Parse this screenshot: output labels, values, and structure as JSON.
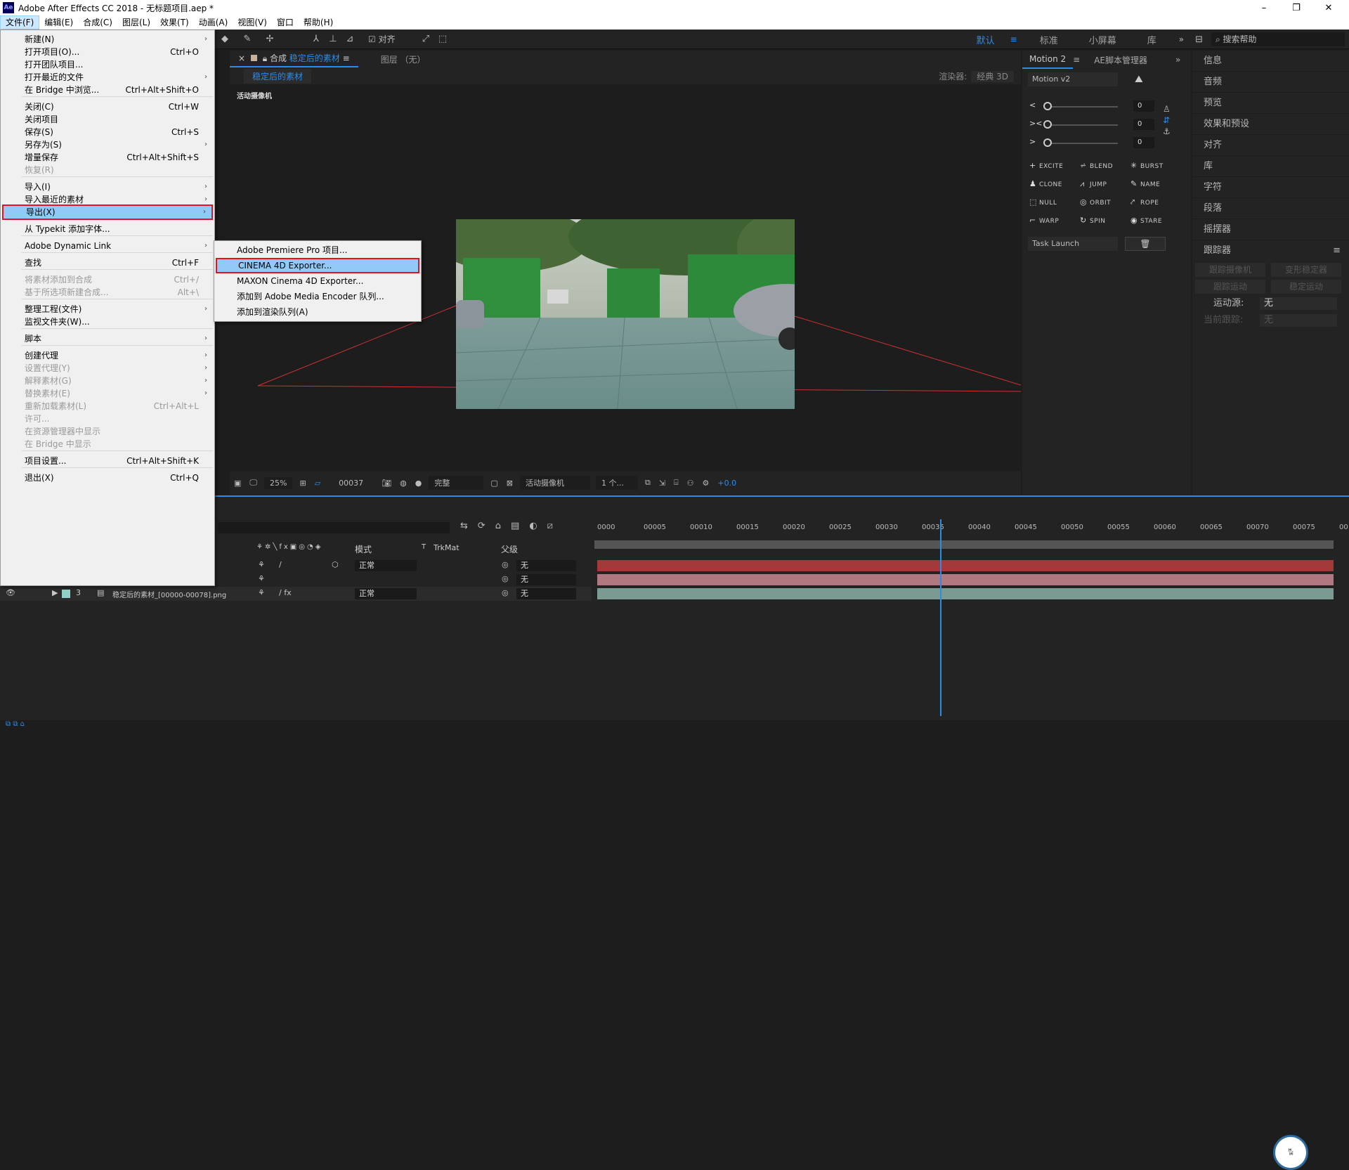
{
  "window": {
    "title": "Adobe After Effects CC 2018 - 无标题项目.aep *",
    "app_icon": "Ae",
    "minimize": "–",
    "restore": "❐",
    "close": "✕"
  },
  "menubar": [
    "文件(F)",
    "编辑(E)",
    "合成(C)",
    "图层(L)",
    "效果(T)",
    "动画(A)",
    "视图(V)",
    "窗口",
    "帮助(H)"
  ],
  "toolbar": {
    "snap_label": "对齐",
    "workspaces": [
      "默认",
      "标准",
      "小屏幕",
      "库"
    ],
    "help_search": "搜索帮助",
    "more": "»"
  },
  "comp_panel": {
    "tab_prefix": "合成",
    "tab_name": "稳定后的素材",
    "layer_tab": "图层 （无）",
    "breadcrumb": "稳定后的素材",
    "renderer_label": "渲染器:",
    "renderer_value": "经典 3D",
    "camera_label": "活动摄像机",
    "bottom": {
      "zoom": "25%",
      "timecode": "00037",
      "resolution": "完整",
      "camera": "活动摄像机",
      "views": "1 个...",
      "exposure": "+0.0"
    }
  },
  "motion_panel": {
    "tabs": [
      "Motion 2",
      "AE脚本管理器"
    ],
    "preset": "Motion v2",
    "slider_values": [
      "0",
      "0",
      "0"
    ],
    "buttons": [
      "EXCITE",
      "BLEND",
      "BURST",
      "CLONE",
      "JUMP",
      "NAME",
      "NULL",
      "ORBIT",
      "ROPE",
      "WARP",
      "SPIN",
      "STARE"
    ],
    "task": "Task Launch"
  },
  "right_panel": {
    "items": [
      "信息",
      "音频",
      "预览",
      "效果和预设",
      "对齐",
      "库",
      "字符",
      "段落",
      "摇摆器"
    ],
    "tracker": {
      "title": "跟踪器",
      "buttons": [
        "跟踪摄像机",
        "变形稳定器",
        "跟踪运动",
        "稳定运动"
      ],
      "source_label": "运动源:",
      "source_value": "无",
      "current_label": "当前跟踪:",
      "current_value": "无"
    }
  },
  "timeline": {
    "columns": {
      "mode": "模式",
      "t": "T",
      "trkmat": "TrkMat",
      "parent": "父级"
    },
    "ruler": [
      "0000",
      "00005",
      "00010",
      "00015",
      "00020",
      "00025",
      "00030",
      "00035",
      "00040",
      "00045",
      "00050",
      "00055",
      "00060",
      "00065",
      "00070",
      "00075",
      "00"
    ],
    "layers": [
      {
        "num": "",
        "name": "",
        "mode": "正常",
        "parent": "无",
        "color": "#a33a3a"
      },
      {
        "num": "",
        "name": "",
        "mode": "",
        "parent": "无",
        "color": "#b07880"
      },
      {
        "num": "3",
        "name": "稳定后的素材_[00000-00078].png",
        "mode": "正常",
        "parent": "无",
        "color": "#7a9a92"
      }
    ]
  },
  "file_menu": [
    {
      "label": "新建(N)",
      "shortcut": "",
      "submenu": true,
      "disabled": false
    },
    {
      "label": "打开项目(O)...",
      "shortcut": "Ctrl+O",
      "submenu": false,
      "disabled": false
    },
    {
      "label": "打开团队项目...",
      "shortcut": "",
      "submenu": false,
      "disabled": false
    },
    {
      "label": "打开最近的文件",
      "shortcut": "",
      "submenu": true,
      "disabled": false
    },
    {
      "label": "在 Bridge 中浏览...",
      "shortcut": "Ctrl+Alt+Shift+O",
      "submenu": false,
      "disabled": false
    },
    {
      "label": "关闭(C)",
      "shortcut": "Ctrl+W",
      "submenu": false,
      "disabled": false
    },
    {
      "label": "关闭项目",
      "shortcut": "",
      "submenu": false,
      "disabled": false
    },
    {
      "label": "保存(S)",
      "shortcut": "Ctrl+S",
      "submenu": false,
      "disabled": false
    },
    {
      "label": "另存为(S)",
      "shortcut": "",
      "submenu": true,
      "disabled": false
    },
    {
      "label": "增量保存",
      "shortcut": "Ctrl+Alt+Shift+S",
      "submenu": false,
      "disabled": false
    },
    {
      "label": "恢复(R)",
      "shortcut": "",
      "submenu": false,
      "disabled": true
    },
    {
      "label": "导入(I)",
      "shortcut": "",
      "submenu": true,
      "disabled": false
    },
    {
      "label": "导入最近的素材",
      "shortcut": "",
      "submenu": true,
      "disabled": false
    },
    {
      "label": "导出(X)",
      "shortcut": "",
      "submenu": true,
      "disabled": false,
      "highlighted": true
    },
    {
      "label": "从 Typekit 添加字体...",
      "shortcut": "",
      "submenu": false,
      "disabled": false
    },
    {
      "label": "Adobe Dynamic Link",
      "shortcut": "",
      "submenu": true,
      "disabled": false
    },
    {
      "label": "查找",
      "shortcut": "Ctrl+F",
      "submenu": false,
      "disabled": false
    },
    {
      "label": "将素材添加到合成",
      "shortcut": "Ctrl+/",
      "submenu": false,
      "disabled": true
    },
    {
      "label": "基于所选项新建合成...",
      "shortcut": "Alt+\\",
      "submenu": false,
      "disabled": true
    },
    {
      "label": "整理工程(文件)",
      "shortcut": "",
      "submenu": true,
      "disabled": false
    },
    {
      "label": "监视文件夹(W)...",
      "shortcut": "",
      "submenu": false,
      "disabled": false
    },
    {
      "label": "脚本",
      "shortcut": "",
      "submenu": true,
      "disabled": false
    },
    {
      "label": "创建代理",
      "shortcut": "",
      "submenu": true,
      "disabled": false
    },
    {
      "label": "设置代理(Y)",
      "shortcut": "",
      "submenu": true,
      "disabled": true
    },
    {
      "label": "解释素材(G)",
      "shortcut": "",
      "submenu": true,
      "disabled": true
    },
    {
      "label": "替换素材(E)",
      "shortcut": "",
      "submenu": true,
      "disabled": true
    },
    {
      "label": "重新加载素材(L)",
      "shortcut": "Ctrl+Alt+L",
      "submenu": false,
      "disabled": true
    },
    {
      "label": "许可...",
      "shortcut": "",
      "submenu": false,
      "disabled": true
    },
    {
      "label": "在资源管理器中显示",
      "shortcut": "",
      "submenu": false,
      "disabled": true
    },
    {
      "label": "在 Bridge 中显示",
      "shortcut": "",
      "submenu": false,
      "disabled": true
    },
    {
      "label": "项目设置...",
      "shortcut": "Ctrl+Alt+Shift+K",
      "submenu": false,
      "disabled": false
    },
    {
      "label": "退出(X)",
      "shortcut": "Ctrl+Q",
      "submenu": false,
      "disabled": false
    }
  ],
  "export_submenu": [
    {
      "label": "Adobe Premiere Pro 项目..."
    },
    {
      "label": "CINEMA 4D Exporter...",
      "highlighted": true
    },
    {
      "label": "MAXON Cinema 4D Exporter..."
    },
    {
      "label": "添加到 Adobe Media Encoder 队列..."
    },
    {
      "label": "添加到渲染队列(A)"
    }
  ],
  "colors": {
    "accent": "#2d8ceb",
    "highlight_border": "#e81123",
    "menu_highlight": "#91c9f7"
  }
}
